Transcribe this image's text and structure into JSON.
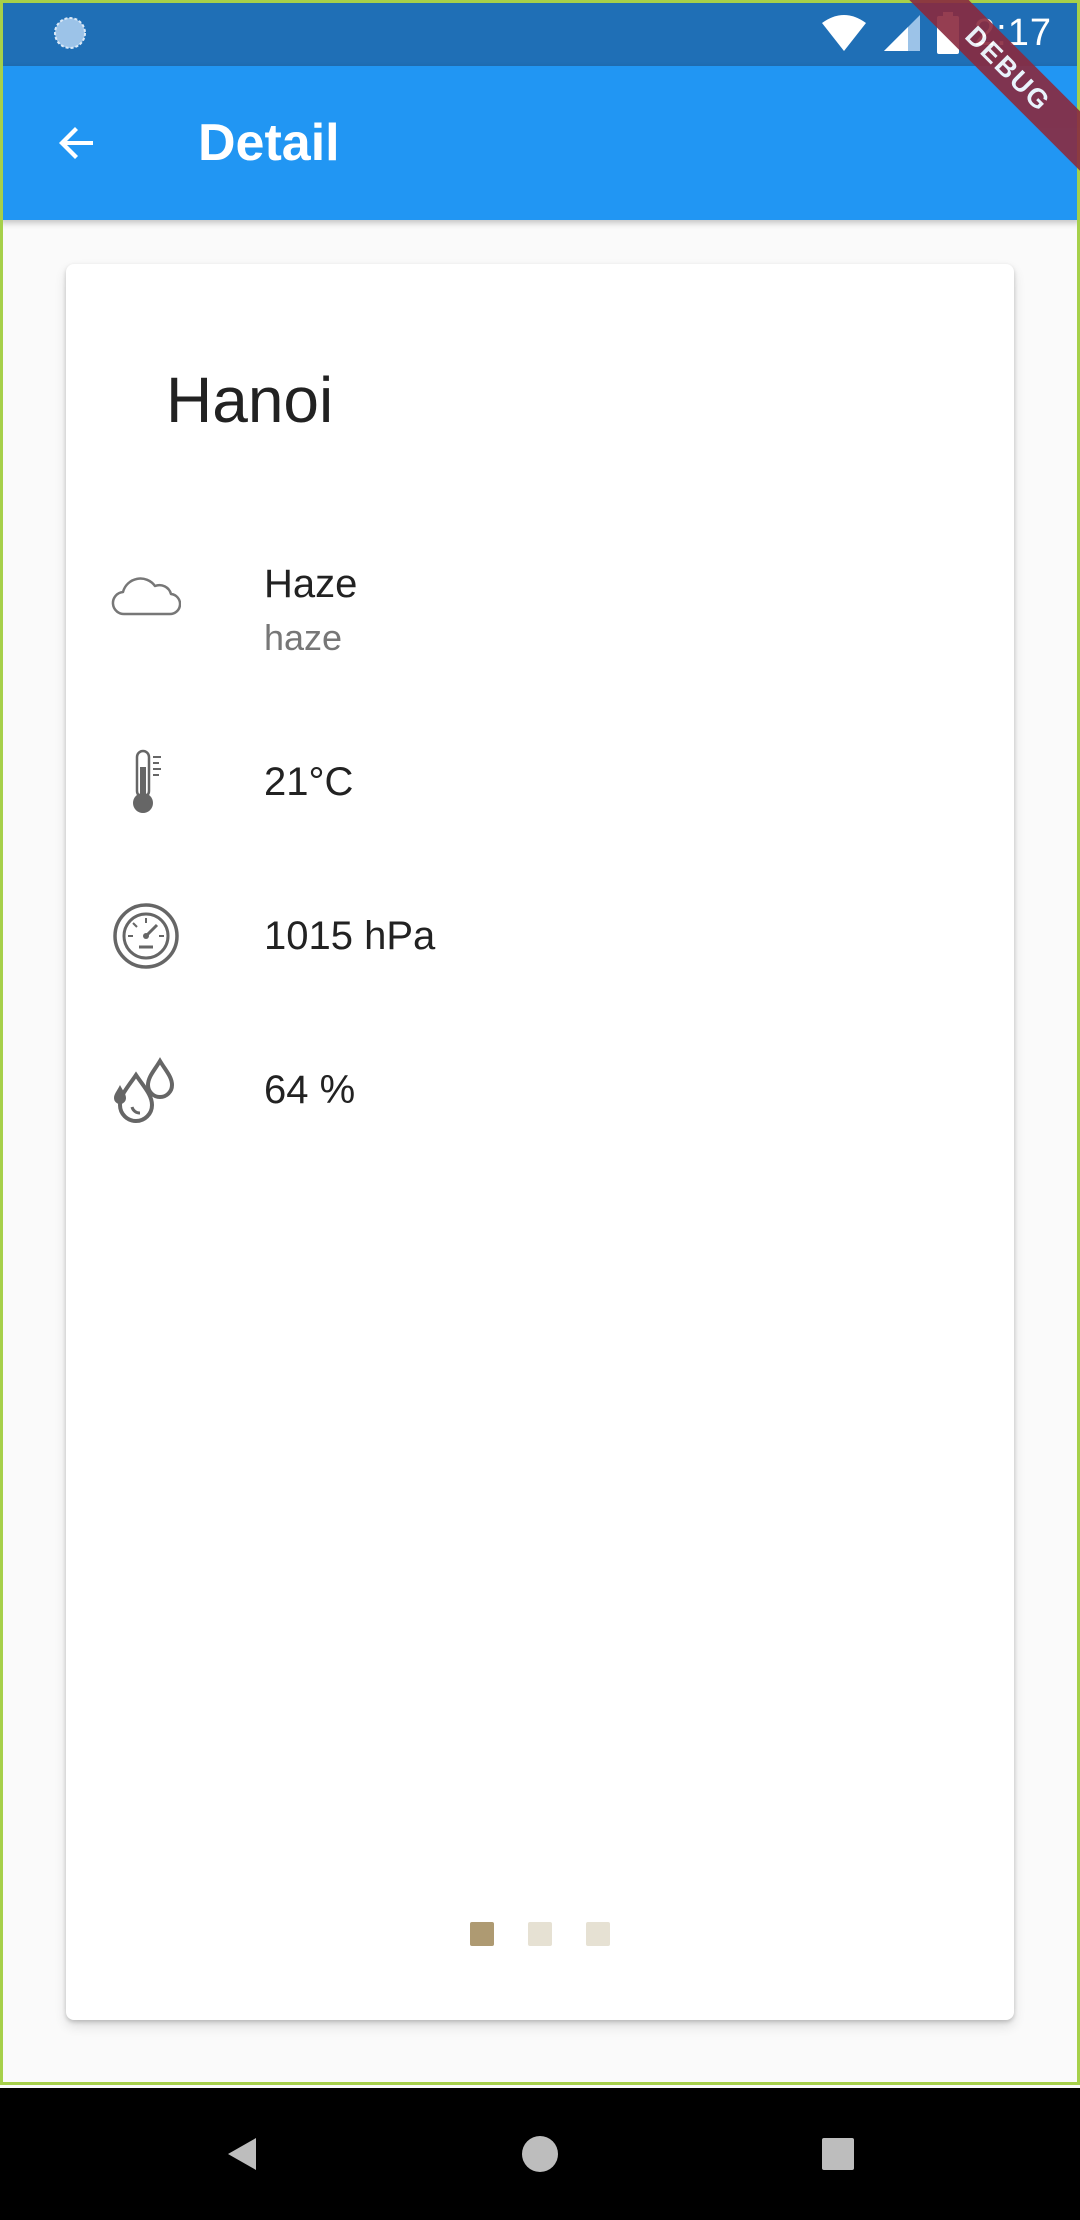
{
  "status_bar": {
    "time": "2:17",
    "background": "#1f6fb6"
  },
  "app_bar": {
    "title": "Detail",
    "color": "#2196f3",
    "back_icon": "arrow-back-icon"
  },
  "debug_banner": "DEBUG",
  "weather": {
    "city": "Hanoi",
    "condition": "Haze",
    "description": "haze",
    "temperature": "21°C",
    "pressure": "1015 hPa",
    "humidity": "64 %",
    "icons": [
      "cloud-icon",
      "thermometer-icon",
      "barometer-icon",
      "humidity-drops-icon"
    ]
  },
  "pager": {
    "count": 3,
    "active_index": 0,
    "active_color": "#ae9a72",
    "inactive_color": "#e6e1d3"
  },
  "nav_bar": {
    "buttons": [
      "back-triangle-icon",
      "home-circle-icon",
      "recents-square-icon"
    ]
  }
}
